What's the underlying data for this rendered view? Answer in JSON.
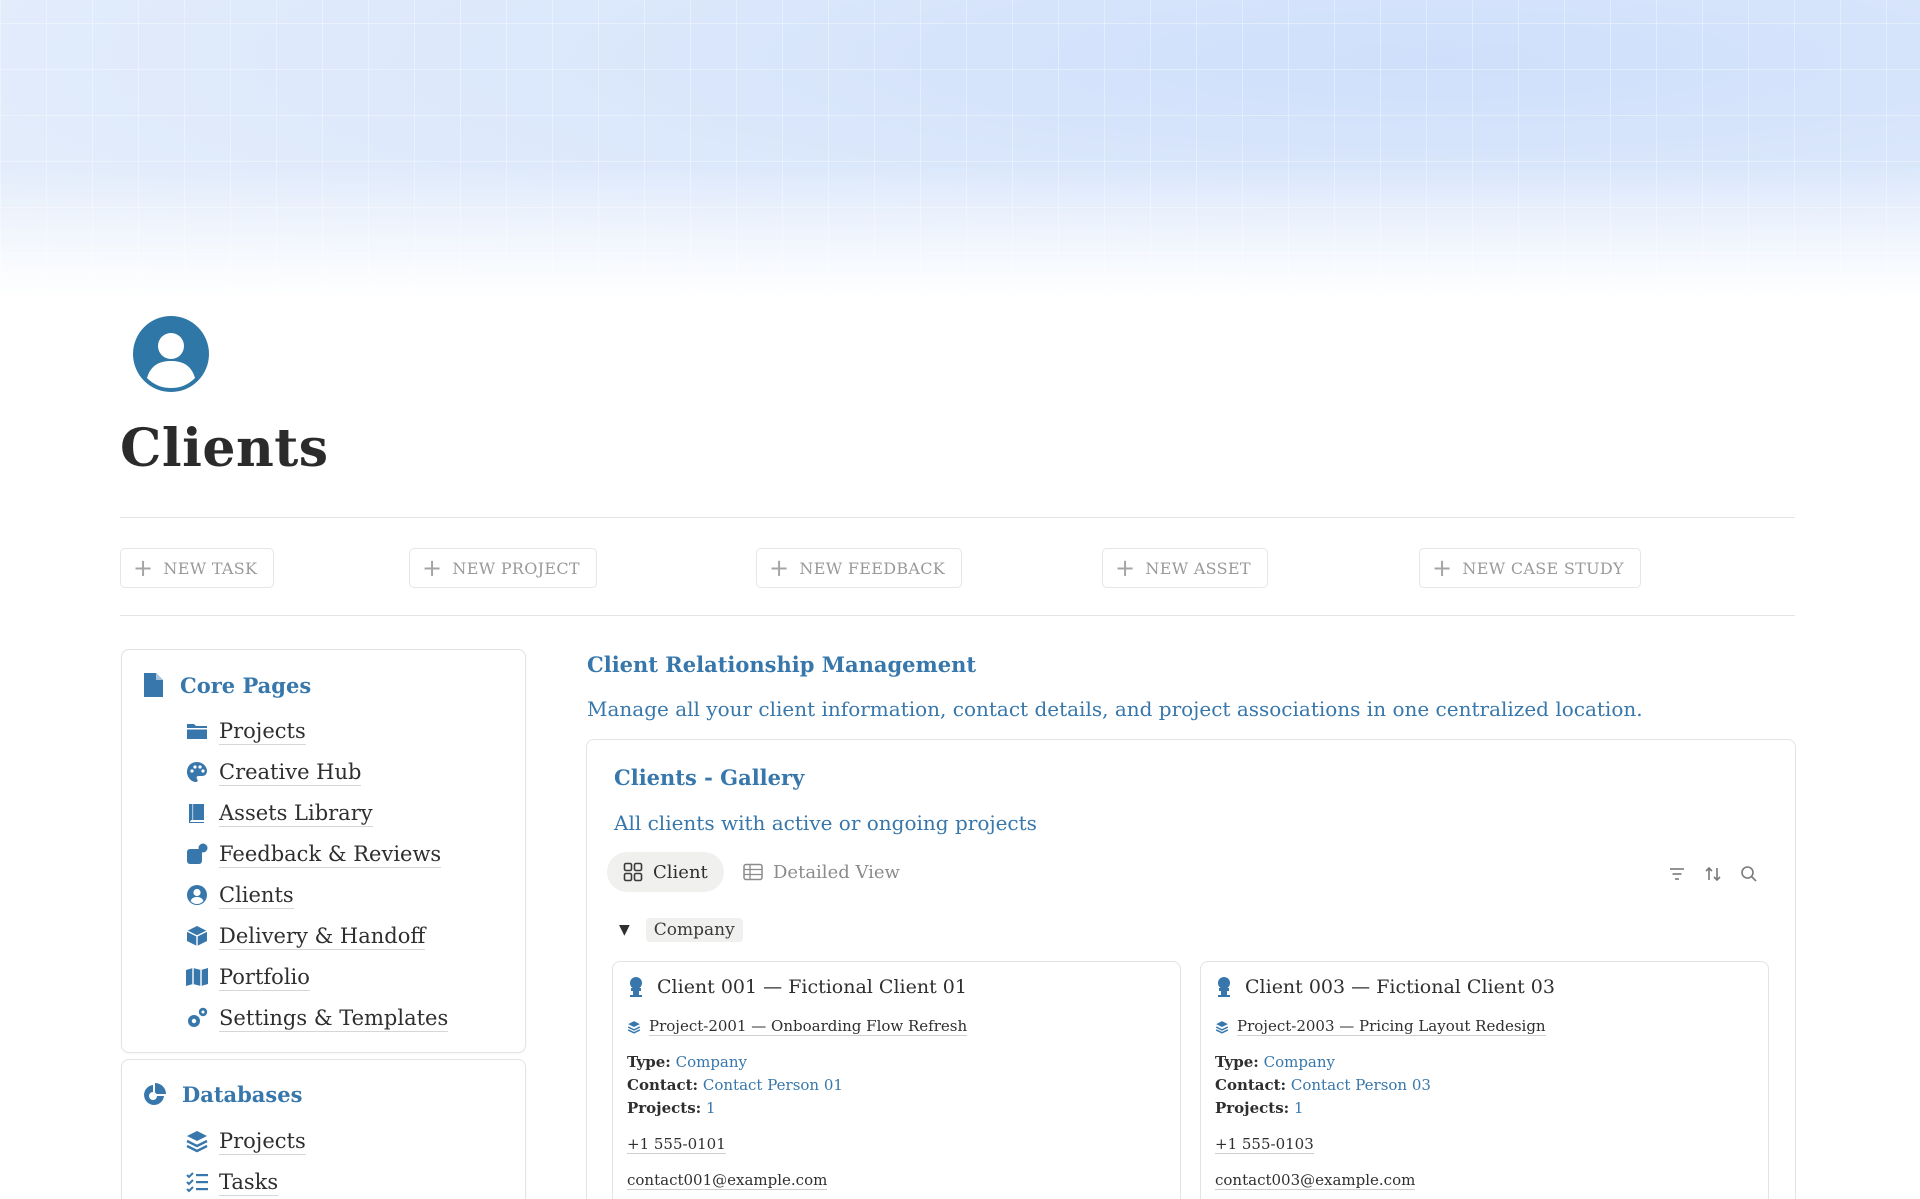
{
  "page": {
    "title": "Clients",
    "icon": "user-circle-icon"
  },
  "actions": [
    {
      "label": "NEW TASK",
      "icon": "plus-icon"
    },
    {
      "label": "NEW PROJECT",
      "icon": "plus-icon"
    },
    {
      "label": "NEW FEEDBACK",
      "icon": "plus-icon"
    },
    {
      "label": "NEW ASSET",
      "icon": "plus-icon"
    },
    {
      "label": "NEW CASE STUDY",
      "icon": "plus-icon"
    }
  ],
  "sidebar": {
    "core": {
      "title": "Core Pages",
      "icon": "document-icon",
      "items": [
        {
          "label": "Projects",
          "icon": "folder-icon"
        },
        {
          "label": "Creative Hub",
          "icon": "palette-icon"
        },
        {
          "label": "Assets Library",
          "icon": "book-icon"
        },
        {
          "label": "Feedback & Reviews",
          "icon": "feedback-icon"
        },
        {
          "label": "Clients",
          "icon": "user-circle-icon"
        },
        {
          "label": "Delivery & Handoff",
          "icon": "box-icon"
        },
        {
          "label": "Portfolio",
          "icon": "map-icon"
        },
        {
          "label": "Settings & Templates",
          "icon": "gears-icon"
        }
      ]
    },
    "databases": {
      "title": "Databases",
      "icon": "pie-chart-icon",
      "items": [
        {
          "label": "Projects",
          "icon": "layers-icon"
        },
        {
          "label": "Tasks",
          "icon": "checklist-icon"
        }
      ]
    }
  },
  "crm": {
    "title": "Client Relationship Management",
    "description": "Manage all your client information, contact details, and project associations in one centralized location."
  },
  "gallery": {
    "title": "Clients - Gallery",
    "description": "All clients with active or ongoing projects",
    "views": [
      {
        "label": "Client",
        "icon": "gallery-icon",
        "active": true
      },
      {
        "label": "Detailed View",
        "icon": "table-icon",
        "active": false
      }
    ],
    "tools": [
      "filter-icon",
      "sort-icon",
      "search-icon"
    ],
    "group": {
      "label": "Company"
    },
    "cards": [
      {
        "name": "Client 001 — Fictional Client 01",
        "project": "Project-2001 — Onboarding Flow Refresh",
        "type_label": "Type:",
        "type": "Company",
        "contact_label": "Contact:",
        "contact": "Contact Person 01",
        "projects_label": "Projects:",
        "projects": "1",
        "phone": "+1 555-0101",
        "email": "contact001@example.com"
      },
      {
        "name": "Client 003 — Fictional Client 03",
        "project": "Project-2003 — Pricing Layout Redesign",
        "type_label": "Type:",
        "type": "Company",
        "contact_label": "Contact:",
        "contact": "Contact Person 03",
        "projects_label": "Projects:",
        "projects": "1",
        "phone": "+1 555-0103",
        "email": "contact003@example.com"
      }
    ]
  },
  "colors": {
    "accent": "#3777ab",
    "text": "#2f2f2f",
    "muted": "#9a9a9a"
  }
}
